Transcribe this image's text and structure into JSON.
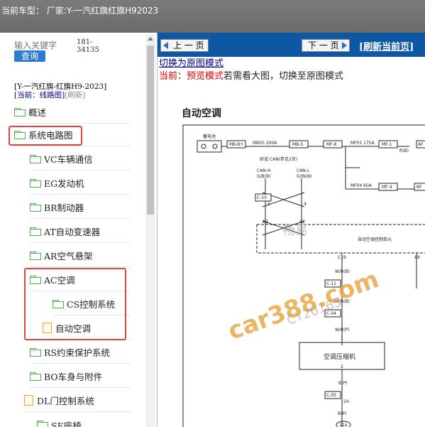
{
  "header": {
    "title": "当前车型：  厂家:Y-一汽红旗红旗H92023"
  },
  "search": {
    "placeholder": "输入关键字",
    "button_label": "查询",
    "counter_line1": "181-",
    "counter_line2": "34135"
  },
  "breadcrumb": {
    "path": "[Y-一汽红旗-红旗H9-2023]",
    "current": "[当前：线路图]",
    "refresh": "[刷新]"
  },
  "tree": [
    {
      "label": "概述",
      "type": "folder"
    },
    {
      "label": "系统电路图",
      "type": "folder"
    },
    {
      "label": "VC车辆通信",
      "type": "folder"
    },
    {
      "label": "EG发动机",
      "type": "folder"
    },
    {
      "label": "BR制动器",
      "type": "folder"
    },
    {
      "label": "AT自动变速器",
      "type": "folder"
    },
    {
      "label": "AR空气悬架",
      "type": "folder"
    },
    {
      "label": "AC空调",
      "type": "folder"
    },
    {
      "label": "CS控制系统",
      "type": "folder"
    },
    {
      "label": "自动空调",
      "type": "doc"
    },
    {
      "label": "RS约束保护系统",
      "type": "folder"
    },
    {
      "label": "BO车身与附件",
      "type": "folder"
    },
    {
      "label": "DL门控制系统",
      "type": "doc"
    },
    {
      "label": "SE座椅",
      "type": "folder"
    }
  ],
  "toolbar": {
    "prev_label": "上 一 页",
    "next_label": "下 一 页",
    "refresh_label": "[刷新当前页]"
  },
  "content": {
    "switch_link": "切换为原图模式",
    "mode_prefix": "当前：预览模式",
    "mode_suffix": "若需看大图，切换至原图模式",
    "diagram_title": "自动空调"
  },
  "diagram": {
    "battery": "蓄电池",
    "mb_b_plus": "MB-B+",
    "mb05": "MB05 200A",
    "mb5": "MB-5",
    "mf6": "MF-6",
    "mf01": "MF01 175A",
    "mf1": "MF-1",
    "af_cut": "AF",
    "r_b": "R(B)",
    "can_title": "舒适 CAN(参见2页)",
    "can_h": "CAN-H",
    "can_l": "CAN-L",
    "can_h_wire": "G/B(B)",
    "can_l_wire": "G/W(B)",
    "mf04": "MF04 60A",
    "mf4": "MF-4",
    "bf_cut": "BF",
    "c10": "C-10",
    "pin5": "5",
    "pin4": "4",
    "a3": "A3",
    "a2": "A2",
    "a6": "A6",
    "c19": "C19",
    "ac_unit": "自动空调控制单元",
    "c11": "C-11",
    "c04": "C-04",
    "c05": "C-05",
    "wire_wr": "W/R(B)",
    "wire_wrp": "W/R(P)",
    "wire_bp": "B(P)",
    "compressor": "空调压缩机",
    "pin1": "1",
    "pin2": "2",
    "pin24": "24",
    "pin12a": "12a"
  },
  "watermark": {
    "main": "car388.com",
    "sub": "畅易",
    "code": "CY20165"
  },
  "colors": {
    "toolbar": "#0d57a3",
    "highlight": "#e0443e",
    "folder": "#4caf50",
    "doc": "#f0a030"
  }
}
